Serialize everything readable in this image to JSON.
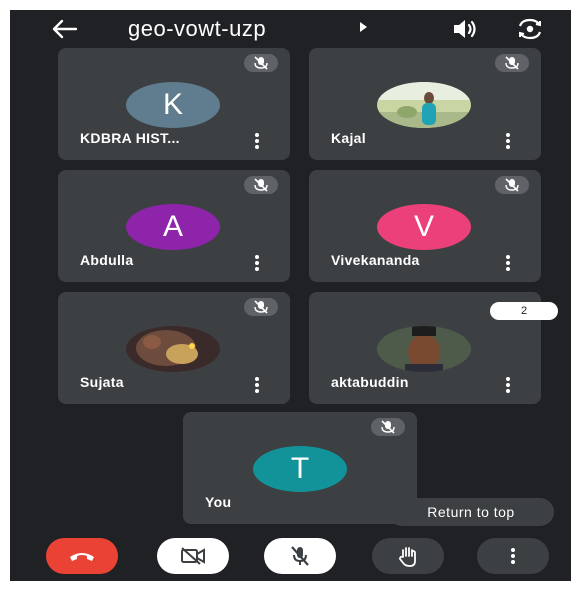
{
  "header": {
    "meeting_code": "geo-vowt-uzp"
  },
  "tiles": [
    {
      "name": "KDBRA HIST...",
      "avatar_letter": "K",
      "avatar_color": "#5f7d8e"
    },
    {
      "name": "Kajal",
      "avatar_type": "photo"
    },
    {
      "name": "Abdulla",
      "avatar_letter": "A",
      "avatar_color": "#8e24aa"
    },
    {
      "name": "Vivekananda",
      "avatar_letter": "V",
      "avatar_color": "#ec407a"
    },
    {
      "name": "Sujata",
      "avatar_type": "photo"
    },
    {
      "name": "aktabuddin",
      "avatar_type": "photo"
    },
    {
      "name": "You",
      "avatar_letter": "T",
      "avatar_color": "#12939a"
    }
  ],
  "scroll": {
    "page_indicator": "2"
  },
  "return_to_top_label": "Return to top",
  "colors": {
    "background": "#202124",
    "tile": "#3c4043",
    "end_call": "#ea4335",
    "control_light": "#ffffff",
    "control_dark": "#3c4043"
  },
  "controls": [
    {
      "icon": "end-call-icon"
    },
    {
      "icon": "camera-off-icon"
    },
    {
      "icon": "mic-off-icon"
    },
    {
      "icon": "raise-hand-icon"
    },
    {
      "icon": "more-options-icon"
    }
  ]
}
